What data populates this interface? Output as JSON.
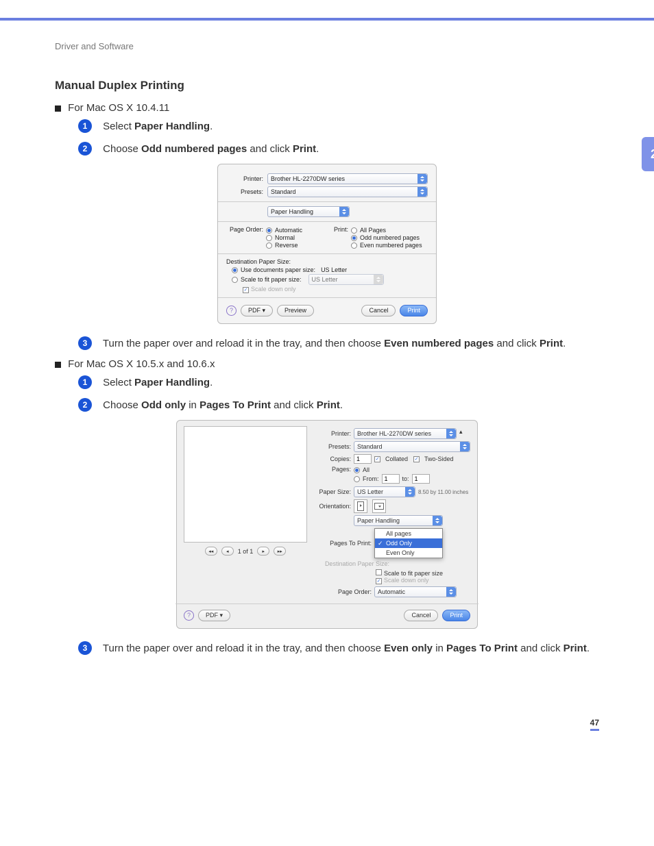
{
  "breadcrumb": "Driver and Software",
  "side_tab": "2",
  "title": "Manual Duplex Printing",
  "section_a": {
    "heading": "For Mac OS X 10.4.11",
    "steps": {
      "1": {
        "prefix": "Select ",
        "bold1": "Paper Handling",
        "suffix": "."
      },
      "2": {
        "prefix": "Choose ",
        "bold1": "Odd numbered pages",
        "mid": " and click ",
        "bold2": "Print",
        "suffix": "."
      },
      "3": {
        "prefix": "Turn the paper over and reload it in the tray, and then choose ",
        "bold1": "Even numbered pages",
        "mid": " and click ",
        "bold2": "Print",
        "suffix": "."
      }
    }
  },
  "section_b": {
    "heading": "For Mac OS X 10.5.x and 10.6.x",
    "steps": {
      "1": {
        "prefix": "Select ",
        "bold1": "Paper Handling",
        "suffix": "."
      },
      "2": {
        "prefix": "Choose ",
        "bold1": "Odd only",
        "mid": " in ",
        "bold2": "Pages To Print",
        "mid2": " and click ",
        "bold3": "Print",
        "suffix": "."
      },
      "3": {
        "prefix": "Turn the paper over and reload it in the tray, and then choose ",
        "bold1": "Even only",
        "mid": " in ",
        "bold2": "Pages To Print",
        "mid2": " and click ",
        "bold3": "Print",
        "suffix": "."
      }
    }
  },
  "dialog1": {
    "printer_label": "Printer:",
    "printer_value": "Brother HL-2270DW series",
    "presets_label": "Presets:",
    "presets_value": "Standard",
    "pane_value": "Paper Handling",
    "page_order_label": "Page Order:",
    "page_order_options": {
      "auto": "Automatic",
      "normal": "Normal",
      "reverse": "Reverse"
    },
    "print_label": "Print:",
    "print_options": {
      "all": "All Pages",
      "odd": "Odd numbered pages",
      "even": "Even numbered pages"
    },
    "dest_size_label": "Destination Paper Size:",
    "dest_opt1": "Use documents paper size:",
    "dest_opt1_value": "US Letter",
    "dest_opt2": "Scale to fit paper size:",
    "dest_opt2_value": "US Letter",
    "scale_down": "Scale down only",
    "pdf_btn": "PDF ▾",
    "preview_btn": "Preview",
    "cancel_btn": "Cancel",
    "print_btn": "Print"
  },
  "dialog2": {
    "printer_label": "Printer:",
    "printer_value": "Brother HL-2270DW series",
    "presets_label": "Presets:",
    "presets_value": "Standard",
    "copies_label": "Copies:",
    "copies_value": "1",
    "collated": "Collated",
    "two_sided": "Two-Sided",
    "pages_label": "Pages:",
    "pages_all": "All",
    "pages_from": "From:",
    "pages_from_val": "1",
    "pages_to": "to:",
    "pages_to_val": "1",
    "paper_size_label": "Paper Size:",
    "paper_size_value": "US Letter",
    "paper_dims": "8.50 by 11.00 inches",
    "orientation_label": "Orientation:",
    "pane_value": "Paper Handling",
    "pages_to_print_label": "Pages To Print:",
    "dropdown": {
      "all": "All pages",
      "odd": "Odd Only",
      "even": "Even Only"
    },
    "dest_size_label": "Destination Paper Size:",
    "scale_fit": "Scale to fit paper size",
    "scale_down": "Scale down only",
    "page_order_label": "Page Order:",
    "page_order_value": "Automatic",
    "nav_count": "1 of 1",
    "pdf_btn": "PDF ▾",
    "cancel_btn": "Cancel",
    "print_btn": "Print"
  },
  "page_number": "47"
}
